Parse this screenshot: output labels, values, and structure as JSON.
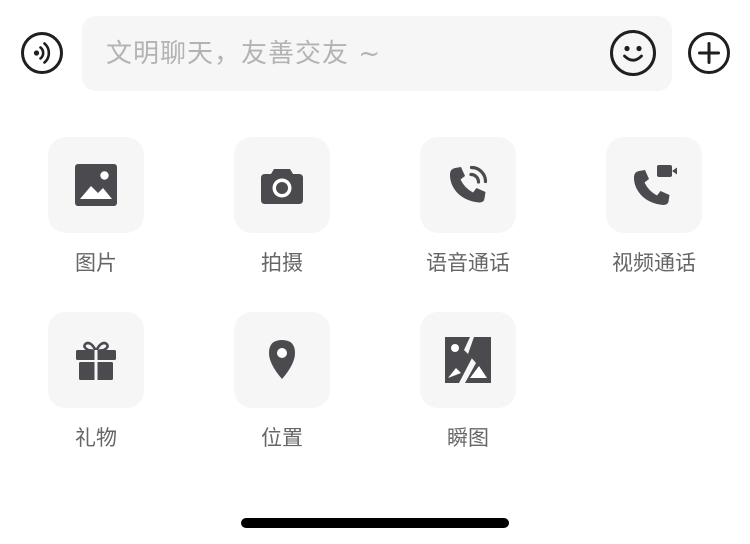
{
  "composer": {
    "placeholder": "文明聊天，友善交友 ~",
    "voice_icon": "voice-input-icon",
    "emoji_icon": "smiley-icon",
    "plus_icon": "plus-icon"
  },
  "panel": {
    "items": [
      {
        "label": "图片",
        "icon": "image-icon"
      },
      {
        "label": "拍摄",
        "icon": "camera-icon"
      },
      {
        "label": "语音通话",
        "icon": "phone-call-icon"
      },
      {
        "label": "视频通话",
        "icon": "video-call-icon"
      },
      {
        "label": "礼物",
        "icon": "gift-icon"
      },
      {
        "label": "位置",
        "icon": "location-pin-icon"
      },
      {
        "label": "瞬图",
        "icon": "flash-image-icon"
      }
    ]
  },
  "colors": {
    "icon": "#4a4a4f",
    "tile_bg": "#f6f6f6",
    "label": "#666666",
    "placeholder": "#b3b3b3",
    "outline_icon": "#1f1f1f"
  }
}
